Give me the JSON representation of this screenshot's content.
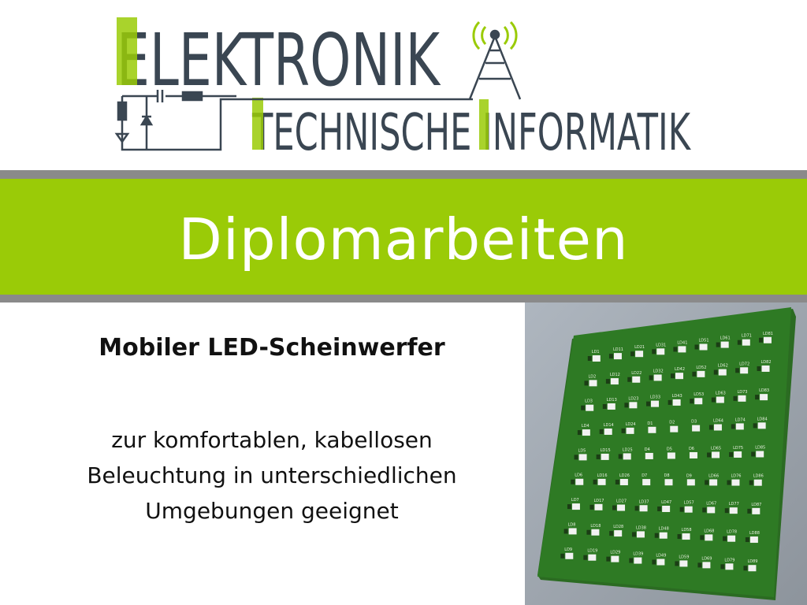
{
  "logo": {
    "line1": "ELEKTRONIK",
    "line2": "TECHNISCHE INFORMATIK",
    "colors": {
      "accent": "#9acb07",
      "dark": "#3a4652"
    }
  },
  "band": {
    "title": "Diplomarbeiten",
    "color": "#9acb07",
    "stripe_color": "#8a8a8a"
  },
  "content": {
    "subtitle": "Mobiler LED-Scheinwerfer",
    "description": [
      "zur komfortablen, kabellosen",
      "Beleuchtung in unterschiedlichen",
      "Umgebungen geeignet"
    ]
  },
  "image": {
    "board_color": "#2e7a24",
    "led_rows": [
      [
        "LD1",
        "LD11",
        "LD21",
        "LD31",
        "LD41",
        "LD51",
        "LD61",
        "LD71",
        "LD81"
      ],
      [
        "LD2",
        "LD12",
        "LD22",
        "LD32",
        "LD42",
        "LD52",
        "LD62",
        "LD72",
        "LD82"
      ],
      [
        "LD3",
        "LD13",
        "LD23",
        "LD33",
        "LD43",
        "LD53",
        "LD63",
        "LD73",
        "LD83"
      ],
      [
        "LD4",
        "LD14",
        "LD24",
        "D1",
        "D2",
        "D3",
        "LD64",
        "LD74",
        "LD84"
      ],
      [
        "LD5",
        "LD15",
        "LD25",
        "D4",
        "D5",
        "D6",
        "LD65",
        "LD75",
        "LD85"
      ],
      [
        "LD6",
        "LD16",
        "LD26",
        "D7",
        "D8",
        "D9",
        "LD66",
        "LD76",
        "LD86"
      ],
      [
        "LD7",
        "LD17",
        "LD27",
        "LD37",
        "LD47",
        "LD57",
        "LD67",
        "LD77",
        "LD87"
      ],
      [
        "LD8",
        "LD18",
        "LD28",
        "LD38",
        "LD48",
        "LD58",
        "LD68",
        "LD78",
        "LD88"
      ],
      [
        "LD9",
        "LD19",
        "LD29",
        "LD39",
        "LD49",
        "LD59",
        "LD69",
        "LD79",
        "LD89"
      ]
    ]
  }
}
